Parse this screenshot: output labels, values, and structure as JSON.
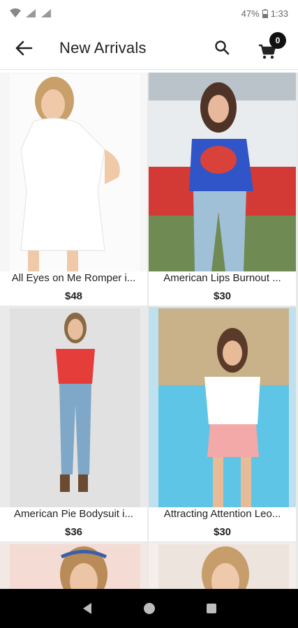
{
  "status_bar": {
    "battery_percent": "47%",
    "time": "1:33"
  },
  "app_bar": {
    "title": "New Arrivals",
    "cart_count": "0",
    "icons": [
      "back-arrow-icon",
      "search-icon",
      "cart-icon"
    ]
  },
  "products": [
    {
      "name": "All Eyes on Me Romper i...",
      "price": "$48",
      "image": "white-romper"
    },
    {
      "name": "American Lips Burnout ...",
      "price": "$30",
      "image": "blue-tee"
    },
    {
      "name": "American Pie Bodysuit i...",
      "price": "$36",
      "image": "red-bodysuit"
    },
    {
      "name": "Attracting Attention Leo...",
      "price": "$30",
      "image": "pink-shorts"
    }
  ],
  "nav_bar": {
    "icons": [
      "back-triangle-icon",
      "home-circle-icon",
      "recents-square-icon"
    ]
  },
  "colors": {
    "background": "#ffffff",
    "divider": "#e9e9e9",
    "text": "#222222",
    "nav_bar": "#000000"
  }
}
